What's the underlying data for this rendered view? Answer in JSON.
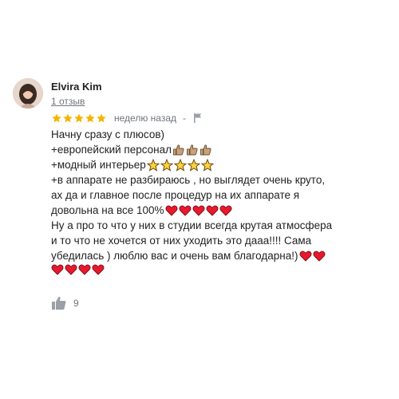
{
  "review": {
    "author": "Elvira Kim",
    "reviews_count": "1 отзыв",
    "rating": 5,
    "time": "неделю назад",
    "separator": "-",
    "lines": [
      "Начну сразу с плюсов)",
      "+европейский персонал",
      "+модный интерьер",
      "+в аппарате не разбираюсь ,  но выглядет очень круто,",
      "ах да и главное после процедур на их аппарате я",
      "довольна на все 100%",
      "Ну а про то что у них в студии всегда крутая атмосфера",
      "и то что не хочется от них уходить это дааа!!!! Сама",
      "убедилась ) люблю вас и очень вам благодарна!)",
      ""
    ],
    "likes": "9"
  },
  "colors": {
    "star": "#f4b400",
    "text": "#202124",
    "muted": "#70757a",
    "heart": "#e8192c",
    "thumb": "#c8a27a"
  },
  "icons": {
    "star": "star-icon",
    "flag": "flag-icon",
    "thumbs_up": "thumbs-up-icon",
    "heart": "heart-emoji",
    "thumb_emoji": "thumbs-up-emoji",
    "star_emoji": "star-emoji"
  }
}
